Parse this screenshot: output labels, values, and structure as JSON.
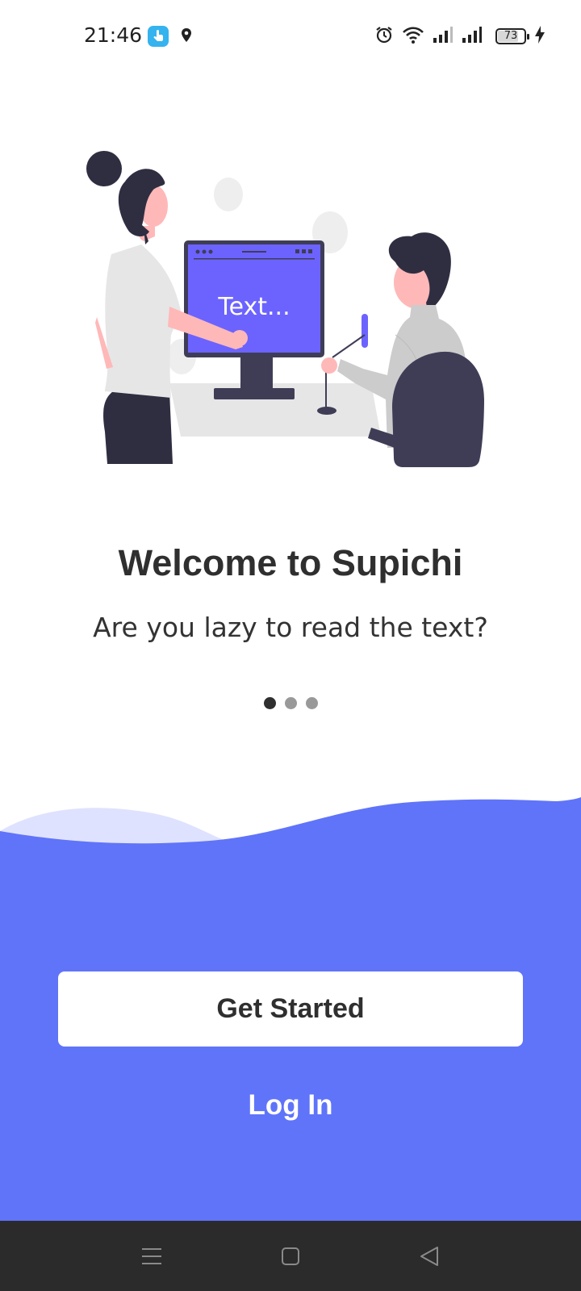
{
  "status_bar": {
    "time": "21:46",
    "battery_level": "73",
    "battery_fraction": 0.73,
    "icons": [
      "app-notification-icon",
      "location-icon",
      "alarm-icon",
      "wifi-icon",
      "signal-icon",
      "signal-icon",
      "battery-icon",
      "charging-icon"
    ]
  },
  "illustration": {
    "screen_text": "Text..."
  },
  "welcome": {
    "title": "Welcome to Supichi",
    "subtitle": "Are you lazy to read the text?"
  },
  "pagination": {
    "current": 1,
    "total": 3
  },
  "actions": {
    "get_started_label": "Get Started",
    "login_label": "Log In"
  },
  "nav_bar": {
    "icons": [
      "menu-icon",
      "home-icon",
      "back-icon"
    ]
  },
  "colors": {
    "accent": "#6074f9",
    "wave_light": "#dfe2fe",
    "nav_bg": "#2b2b2b",
    "illustration_screen": "#6c63ff",
    "text_dark": "#2f2f2f"
  }
}
